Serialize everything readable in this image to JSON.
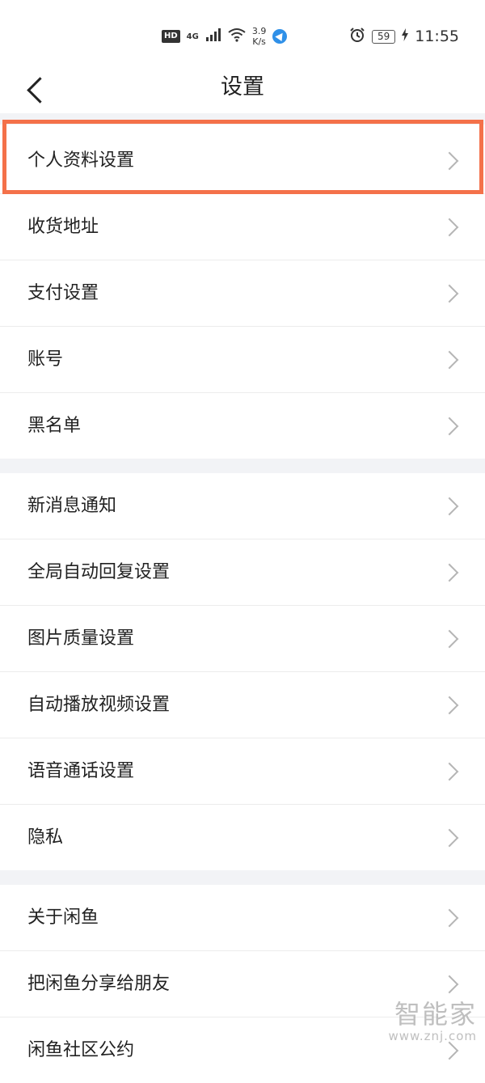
{
  "status_bar": {
    "hd": "HD",
    "network": "4G",
    "speed_value": "3.9",
    "speed_unit": "K/s",
    "battery": "59",
    "time": "11:55"
  },
  "header": {
    "title": "设置"
  },
  "groups": [
    {
      "items": [
        {
          "label": "个人资料设置"
        },
        {
          "label": "收货地址"
        },
        {
          "label": "支付设置"
        },
        {
          "label": "账号"
        },
        {
          "label": "黑名单"
        }
      ]
    },
    {
      "items": [
        {
          "label": "新消息通知"
        },
        {
          "label": "全局自动回复设置"
        },
        {
          "label": "图片质量设置"
        },
        {
          "label": "自动播放视频设置"
        },
        {
          "label": "语音通话设置"
        },
        {
          "label": "隐私"
        }
      ]
    },
    {
      "items": [
        {
          "label": "关于闲鱼"
        },
        {
          "label": "把闲鱼分享给朋友"
        },
        {
          "label": "闲鱼社区公约"
        }
      ]
    }
  ],
  "watermark": {
    "name": "智能家",
    "url": "www.znj.com"
  },
  "colors": {
    "highlight": "#f4714a",
    "separator": "#f2f3f6"
  }
}
